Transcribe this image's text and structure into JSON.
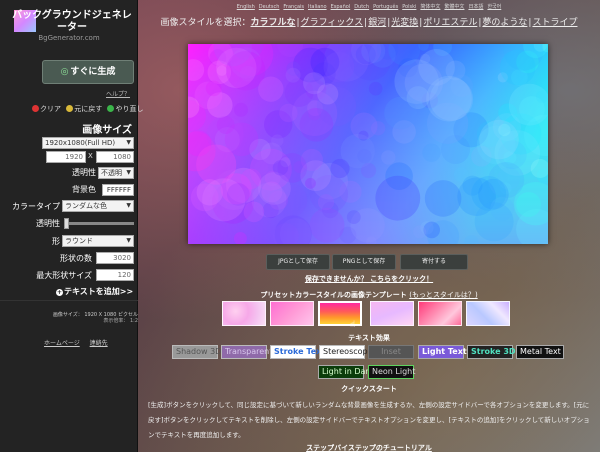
{
  "app": {
    "title": "バックグラウンドジェネレーター",
    "subtitle": "BgGenerator.com"
  },
  "languages": [
    "English",
    "Deutsch",
    "Français",
    "Italiano",
    "Español",
    "Dutch",
    "Português",
    "Polski",
    "简体中文",
    "繁體中文",
    "日本語",
    "한국어"
  ],
  "style_bar": {
    "prefix": "画像スタイルを選択：",
    "options": [
      "カラフルな",
      "グラフィックス",
      "銀河",
      "光変換",
      "ポリエステル",
      "夢のような",
      "ストライプ"
    ],
    "active": "カラフルな"
  },
  "sidebar": {
    "generate_label": "すぐに生成",
    "help_label": "ヘルプ？",
    "clear_label": "クリア",
    "undo_label": "元に戻す",
    "redo_label": "やり直し",
    "image_size_label": "画像サイズ",
    "size_select": "1920x1080(Full HD)",
    "width": "1920",
    "height": "1080",
    "times": "X",
    "transparency_label": "透明性",
    "transparency_value": "不透明",
    "bgcolor_label": "背景色",
    "bgcolor_value": "FFFFFF",
    "color_type_label": "カラータイプ",
    "color_type_value": "ランダムな色",
    "opacity_label": "透明性",
    "shape_label": "形",
    "shape_value": "ラウンド",
    "shape_count_label": "形状の数",
    "shape_count_value": "3020",
    "max_size_label": "最大形状サイズ",
    "max_size_value": "120",
    "add_text_label": "テキストを追加>>",
    "size_info_label": "画像サイズ：",
    "size_info_value": "1920 X 1080 ピクセル",
    "ratio_label": "表示倍率：",
    "ratio_value": "1:2",
    "home_link": "ホームページ",
    "contact_link": "連絡先"
  },
  "actions": {
    "save_jpg": "JPGとして保存",
    "save_png": "PNGとして保存",
    "donate": "寄付する"
  },
  "not_saved_label": "保存できませんか？ こちらをクリック！",
  "templates": {
    "title": "プリセットカラースタイルの画像テンプレート",
    "more_label": "もっとスタイルは？"
  },
  "text_effects": {
    "title": "テキスト効果",
    "items": [
      "Shadow 3D",
      "Transparent",
      "Stroke Text",
      "Stereoscopic",
      "Inset",
      "Light Text",
      "Stroke 3D",
      "Metal Text",
      "Light in Dark",
      "Neon Light"
    ]
  },
  "quickstart": {
    "title": "クイックスタート",
    "line1": "[生成]ボタンをクリックして、同じ設定に基づいて新しいランダムな背景画像を生成するか、左側の設定サイドバーで各オプションを変更します。[元に",
    "line2": "戻す]ボタンをクリックしてテキストを削除し、左側の設定サイドバーでテキストオプションを変更し、[テキストの追加]をクリックして新しいオプショ",
    "line3": "ンでテキストを再度追加します。",
    "tutorial": "ステップバイステップのチュートリアル"
  },
  "colors": {
    "sidebar_bg": "#232323",
    "generate_bg": "#4a5a52",
    "preview_left": "#ff00ff",
    "preview_right": "#00e5ff"
  }
}
